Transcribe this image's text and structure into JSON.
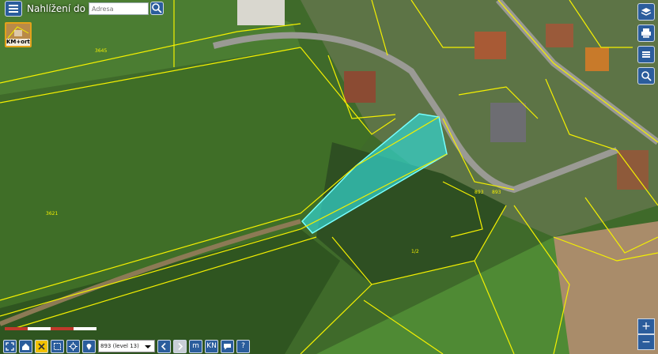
{
  "app": {
    "title": "Nahlížení do KN"
  },
  "search": {
    "placeholder": "Adresa"
  },
  "layer_thumb": {
    "label": "KM+orto"
  },
  "parcel_labels": [
    "3645",
    "3621",
    "893",
    "893",
    "1/2"
  ],
  "scale": {
    "selected": "893 (level 13)"
  },
  "bottom_toolbar": {
    "kn_label": "KN",
    "m_label": "m",
    "help_label": "?"
  },
  "zoom": {
    "in_label": "+",
    "out_label": "−"
  },
  "colors": {
    "parcel_line": "#f4f000",
    "highlight": "#33d6d0",
    "button": "#2b5d9c",
    "active": "#f2c200"
  }
}
